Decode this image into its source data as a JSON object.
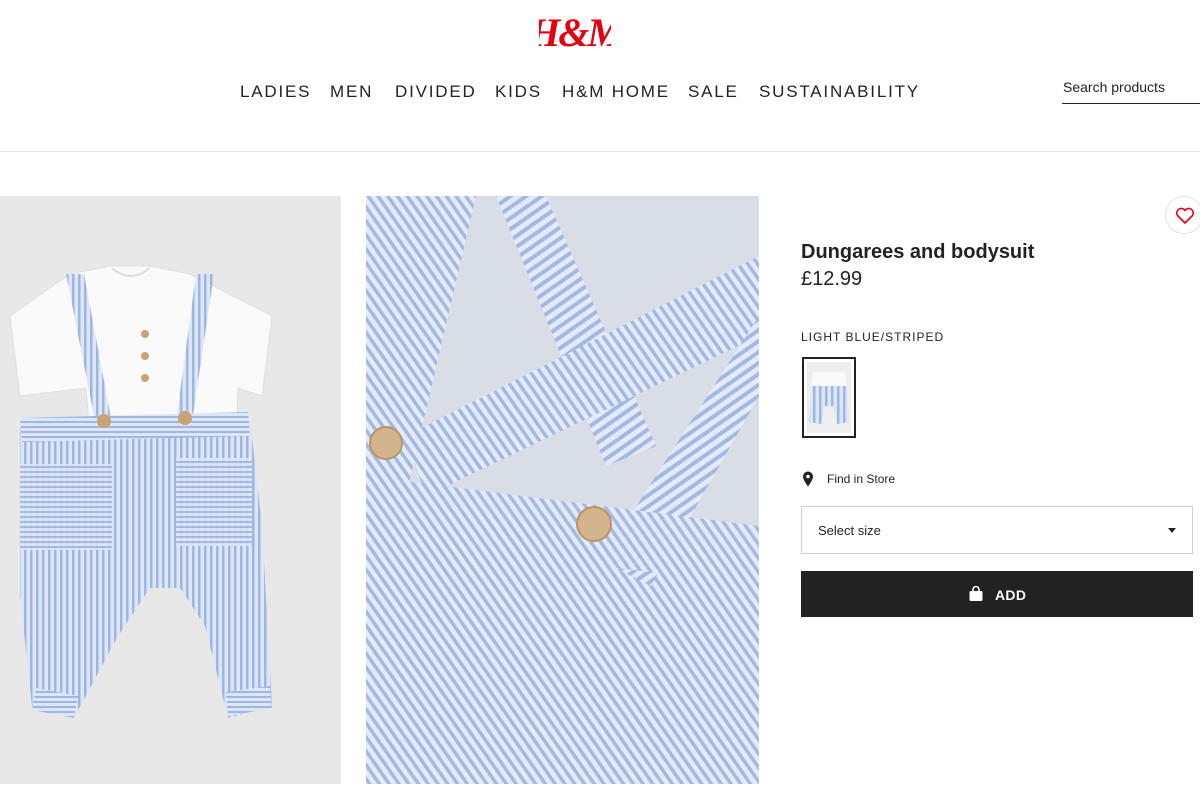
{
  "brand": {
    "logo_text": "H&M",
    "color": "#e50010"
  },
  "nav": {
    "items": [
      "LADIES",
      "MEN",
      "DIVIDED",
      "KIDS",
      "H&M HOME",
      "SALE",
      "SUSTAINABILITY"
    ]
  },
  "search": {
    "placeholder": "Search products"
  },
  "product": {
    "title": "Dungarees and bodysuit",
    "price": "£12.99",
    "color_name": "LIGHT BLUE/STRIPED"
  },
  "actions": {
    "find_in_store": "Find in Store",
    "size_select_label": "Select size",
    "add_label": "ADD"
  },
  "icons": {
    "favorite": "heart-icon",
    "store": "location-pin-icon",
    "bag": "shopping-bag-icon",
    "dropdown": "chevron-down-icon"
  },
  "colors": {
    "accent": "#e50010",
    "button_bg": "#222222",
    "stripe_blue": "#9fb6e3"
  }
}
